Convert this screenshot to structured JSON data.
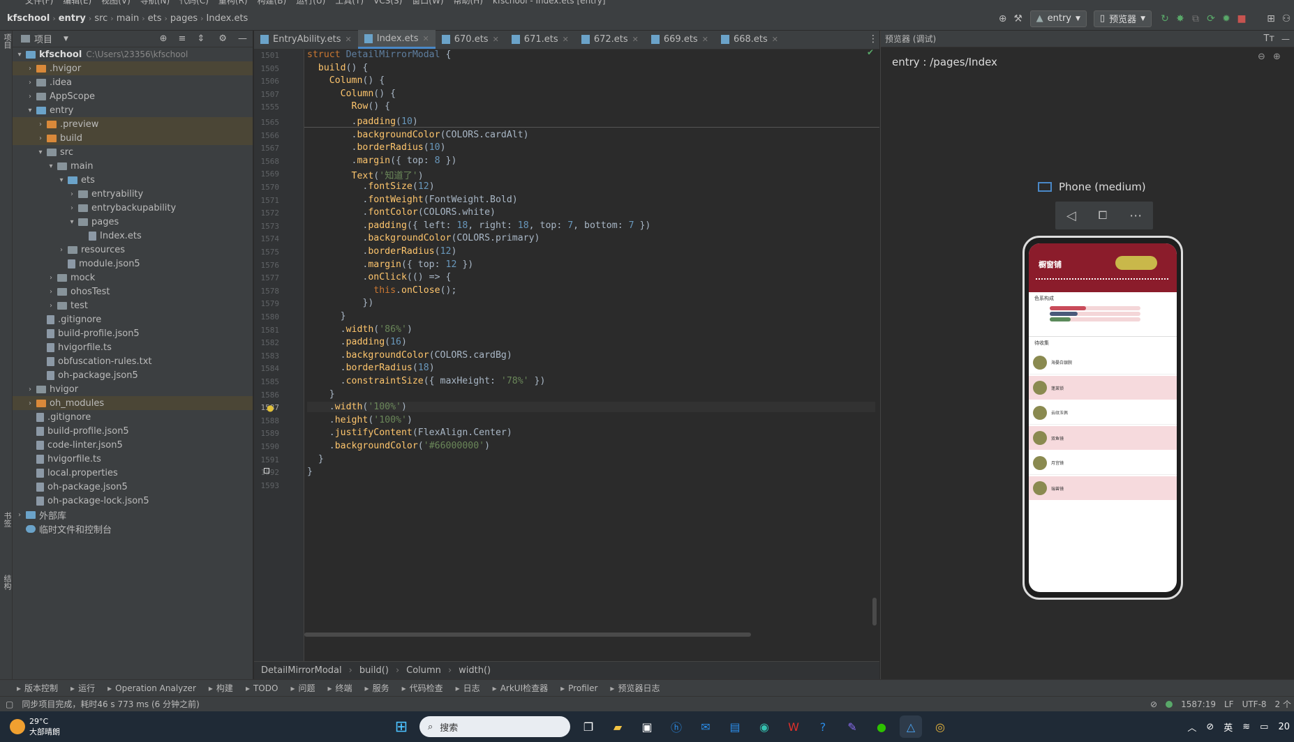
{
  "menu": [
    "文件(F)",
    "编辑(E)",
    "视图(V)",
    "导航(N)",
    "代码(C)",
    "重构(R)",
    "构建(B)",
    "运行(U)",
    "工具(T)",
    "VCS(S)",
    "窗口(W)",
    "帮助(H)",
    "kfschool - Index.ets [entry]"
  ],
  "navbar": {
    "crumbs": [
      "kfschool",
      "entry",
      "src",
      "main",
      "ets",
      "pages",
      "Index.ets"
    ],
    "run_config": "entry",
    "preview_button": "预览器"
  },
  "left_strip": {
    "top_label": "项目",
    "mid_label": "书签",
    "bottom_label": "结构"
  },
  "project": {
    "title": "项目",
    "tree": [
      {
        "label": "kfschool",
        "path": "C:\\Users\\23356\\kfschool",
        "level": 0,
        "arrow": "▾",
        "type": "folder-mod",
        "bold": true
      },
      {
        "label": ".hvigor",
        "level": 1,
        "arrow": "›",
        "type": "folder-orange",
        "hl": true
      },
      {
        "label": ".idea",
        "level": 1,
        "arrow": "›",
        "type": "folder"
      },
      {
        "label": "AppScope",
        "level": 1,
        "arrow": "›",
        "type": "folder"
      },
      {
        "label": "entry",
        "level": 1,
        "arrow": "▾",
        "type": "folder-mod"
      },
      {
        "label": ".preview",
        "level": 2,
        "arrow": "›",
        "type": "folder-orange",
        "hl": true
      },
      {
        "label": "build",
        "level": 2,
        "arrow": "›",
        "type": "folder-orange",
        "hl": true
      },
      {
        "label": "src",
        "level": 2,
        "arrow": "▾",
        "type": "folder"
      },
      {
        "label": "main",
        "level": 3,
        "arrow": "▾",
        "type": "folder"
      },
      {
        "label": "ets",
        "level": 4,
        "arrow": "▾",
        "type": "folder-blue"
      },
      {
        "label": "entryability",
        "level": 5,
        "arrow": "›",
        "type": "folder"
      },
      {
        "label": "entrybackupability",
        "level": 5,
        "arrow": "›",
        "type": "folder"
      },
      {
        "label": "pages",
        "level": 5,
        "arrow": "▾",
        "type": "folder"
      },
      {
        "label": "Index.ets",
        "level": 6,
        "arrow": "",
        "type": "file"
      },
      {
        "label": "resources",
        "level": 4,
        "arrow": "›",
        "type": "folder"
      },
      {
        "label": "module.json5",
        "level": 4,
        "arrow": "",
        "type": "file"
      },
      {
        "label": "mock",
        "level": 3,
        "arrow": "›",
        "type": "folder"
      },
      {
        "label": "ohosTest",
        "level": 3,
        "arrow": "›",
        "type": "folder"
      },
      {
        "label": "test",
        "level": 3,
        "arrow": "›",
        "type": "folder"
      },
      {
        "label": ".gitignore",
        "level": 2,
        "arrow": "",
        "type": "file"
      },
      {
        "label": "build-profile.json5",
        "level": 2,
        "arrow": "",
        "type": "file"
      },
      {
        "label": "hvigorfile.ts",
        "level": 2,
        "arrow": "",
        "type": "file"
      },
      {
        "label": "obfuscation-rules.txt",
        "level": 2,
        "arrow": "",
        "type": "file"
      },
      {
        "label": "oh-package.json5",
        "level": 2,
        "arrow": "",
        "type": "file"
      },
      {
        "label": "hvigor",
        "level": 1,
        "arrow": "›",
        "type": "folder"
      },
      {
        "label": "oh_modules",
        "level": 1,
        "arrow": "›",
        "type": "folder-orange",
        "hl": true
      },
      {
        "label": ".gitignore",
        "level": 1,
        "arrow": "",
        "type": "file"
      },
      {
        "label": "build-profile.json5",
        "level": 1,
        "arrow": "",
        "type": "file"
      },
      {
        "label": "code-linter.json5",
        "level": 1,
        "arrow": "",
        "type": "file"
      },
      {
        "label": "hvigorfile.ts",
        "level": 1,
        "arrow": "",
        "type": "file"
      },
      {
        "label": "local.properties",
        "level": 1,
        "arrow": "",
        "type": "file"
      },
      {
        "label": "oh-package.json5",
        "level": 1,
        "arrow": "",
        "type": "file"
      },
      {
        "label": "oh-package-lock.json5",
        "level": 1,
        "arrow": "",
        "type": "file"
      },
      {
        "label": "外部库",
        "level": 0,
        "arrow": "›",
        "type": "lib"
      },
      {
        "label": "临时文件和控制台",
        "level": 0,
        "arrow": "",
        "type": "scratch"
      }
    ]
  },
  "tabs": [
    {
      "label": "EntryAbility.ets",
      "active": false
    },
    {
      "label": "Index.ets",
      "active": true
    },
    {
      "label": "670.ets",
      "active": false
    },
    {
      "label": "671.ets",
      "active": false
    },
    {
      "label": "672.ets",
      "active": false
    },
    {
      "label": "669.ets",
      "active": false
    },
    {
      "label": "668.ets",
      "active": false
    }
  ],
  "editor": {
    "current_line": "1587",
    "lines": [
      {
        "n": "1501",
        "toks": [
          [
            "kw",
            "struct "
          ],
          [
            "cls",
            "DetailMirrorModal "
          ],
          [
            "plain",
            "{"
          ]
        ]
      },
      {
        "n": "1505",
        "toks": [
          [
            "plain",
            "  "
          ],
          [
            "fn",
            "build"
          ],
          [
            "plain",
            "() {"
          ]
        ]
      },
      {
        "n": "1506",
        "toks": [
          [
            "plain",
            "    "
          ],
          [
            "fn",
            "Column"
          ],
          [
            "plain",
            "() {"
          ]
        ]
      },
      {
        "n": "1507",
        "toks": [
          [
            "plain",
            "      "
          ],
          [
            "fn",
            "Column"
          ],
          [
            "plain",
            "() {"
          ]
        ]
      },
      {
        "n": "1555",
        "toks": [
          [
            "plain",
            "        "
          ],
          [
            "fn",
            "Row"
          ],
          [
            "plain",
            "() {"
          ]
        ]
      },
      {
        "n": "1565",
        "toks": [
          [
            "plain",
            "        ."
          ],
          [
            "mt",
            "padding"
          ],
          [
            "plain",
            "("
          ],
          [
            "num",
            "10"
          ],
          [
            "plain",
            ")"
          ]
        ]
      },
      {
        "n": "1566",
        "toks": [
          [
            "plain",
            "        ."
          ],
          [
            "mt",
            "backgroundColor"
          ],
          [
            "plain",
            "(COLORS."
          ],
          [
            "plain",
            "cardAlt"
          ],
          [
            "plain",
            ")"
          ]
        ]
      },
      {
        "n": "1567",
        "toks": [
          [
            "plain",
            "        ."
          ],
          [
            "mt",
            "borderRadius"
          ],
          [
            "plain",
            "("
          ],
          [
            "num",
            "10"
          ],
          [
            "plain",
            ")"
          ]
        ]
      },
      {
        "n": "1568",
        "toks": [
          [
            "plain",
            "        ."
          ],
          [
            "mt",
            "margin"
          ],
          [
            "plain",
            "({ top: "
          ],
          [
            "num",
            "8"
          ],
          [
            "plain",
            " })"
          ]
        ]
      },
      {
        "n": "1569",
        "toks": [
          [
            "plain",
            "        "
          ],
          [
            "fn",
            "Text"
          ],
          [
            "plain",
            "("
          ],
          [
            "str",
            "'知道了'"
          ],
          [
            "plain",
            ")"
          ]
        ]
      },
      {
        "n": "1570",
        "toks": [
          [
            "plain",
            "          ."
          ],
          [
            "mt",
            "fontSize"
          ],
          [
            "plain",
            "("
          ],
          [
            "num",
            "12"
          ],
          [
            "plain",
            ")"
          ]
        ]
      },
      {
        "n": "1571",
        "toks": [
          [
            "plain",
            "          ."
          ],
          [
            "mt",
            "fontWeight"
          ],
          [
            "plain",
            "(FontWeight.Bold)"
          ]
        ]
      },
      {
        "n": "1572",
        "toks": [
          [
            "plain",
            "          ."
          ],
          [
            "mt",
            "fontColor"
          ],
          [
            "plain",
            "(COLORS.white)"
          ]
        ]
      },
      {
        "n": "1573",
        "toks": [
          [
            "plain",
            "          ."
          ],
          [
            "mt",
            "padding"
          ],
          [
            "plain",
            "({ left: "
          ],
          [
            "num",
            "18"
          ],
          [
            "plain",
            ", right: "
          ],
          [
            "num",
            "18"
          ],
          [
            "plain",
            ", top: "
          ],
          [
            "num",
            "7"
          ],
          [
            "plain",
            ", bottom: "
          ],
          [
            "num",
            "7"
          ],
          [
            "plain",
            " })"
          ]
        ]
      },
      {
        "n": "1574",
        "toks": [
          [
            "plain",
            "          ."
          ],
          [
            "mt",
            "backgroundColor"
          ],
          [
            "plain",
            "(COLORS.primary)"
          ]
        ]
      },
      {
        "n": "1575",
        "toks": [
          [
            "plain",
            "          ."
          ],
          [
            "mt",
            "borderRadius"
          ],
          [
            "plain",
            "("
          ],
          [
            "num",
            "12"
          ],
          [
            "plain",
            ")"
          ]
        ]
      },
      {
        "n": "1576",
        "toks": [
          [
            "plain",
            "          ."
          ],
          [
            "mt",
            "margin"
          ],
          [
            "plain",
            "({ top: "
          ],
          [
            "num",
            "12"
          ],
          [
            "plain",
            " })"
          ]
        ]
      },
      {
        "n": "1577",
        "toks": [
          [
            "plain",
            "          ."
          ],
          [
            "mt",
            "onClick"
          ],
          [
            "plain",
            "(() => {"
          ]
        ]
      },
      {
        "n": "1578",
        "toks": [
          [
            "plain",
            "            "
          ],
          [
            "kw",
            "this"
          ],
          [
            "plain",
            "."
          ],
          [
            "mt",
            "onClose"
          ],
          [
            "plain",
            "();"
          ]
        ]
      },
      {
        "n": "1579",
        "toks": [
          [
            "plain",
            "          })"
          ]
        ]
      },
      {
        "n": "1580",
        "toks": [
          [
            "plain",
            "      }"
          ]
        ]
      },
      {
        "n": "1581",
        "toks": [
          [
            "plain",
            "      ."
          ],
          [
            "mt",
            "width"
          ],
          [
            "plain",
            "("
          ],
          [
            "str",
            "'86%'"
          ],
          [
            "plain",
            ")"
          ]
        ]
      },
      {
        "n": "1582",
        "toks": [
          [
            "plain",
            "      ."
          ],
          [
            "mt",
            "padding"
          ],
          [
            "plain",
            "("
          ],
          [
            "num",
            "16"
          ],
          [
            "plain",
            ")"
          ]
        ]
      },
      {
        "n": "1583",
        "toks": [
          [
            "plain",
            "      ."
          ],
          [
            "mt",
            "backgroundColor"
          ],
          [
            "plain",
            "(COLORS.cardBg)"
          ]
        ]
      },
      {
        "n": "1584",
        "toks": [
          [
            "plain",
            "      ."
          ],
          [
            "mt",
            "borderRadius"
          ],
          [
            "plain",
            "("
          ],
          [
            "num",
            "18"
          ],
          [
            "plain",
            ")"
          ]
        ]
      },
      {
        "n": "1585",
        "toks": [
          [
            "plain",
            "      ."
          ],
          [
            "mt",
            "constraintSize"
          ],
          [
            "plain",
            "({ maxHeight: "
          ],
          [
            "str",
            "'78%'"
          ],
          [
            "plain",
            " })"
          ]
        ]
      },
      {
        "n": "1586",
        "toks": [
          [
            "plain",
            "    }"
          ]
        ]
      },
      {
        "n": "1587",
        "toks": [
          [
            "plain",
            "    ."
          ],
          [
            "mt",
            "width"
          ],
          [
            "plain",
            "("
          ],
          [
            "str",
            "'100%'"
          ],
          [
            "plain",
            ")"
          ]
        ]
      },
      {
        "n": "1588",
        "toks": [
          [
            "plain",
            "    ."
          ],
          [
            "mt",
            "height"
          ],
          [
            "plain",
            "("
          ],
          [
            "str",
            "'100%'"
          ],
          [
            "plain",
            ")"
          ]
        ]
      },
      {
        "n": "1589",
        "toks": [
          [
            "plain",
            "    ."
          ],
          [
            "mt",
            "justifyContent"
          ],
          [
            "plain",
            "(FlexAlign.Center)"
          ]
        ]
      },
      {
        "n": "1590",
        "toks": [
          [
            "plain",
            "    ."
          ],
          [
            "mt",
            "backgroundColor"
          ],
          [
            "plain",
            "("
          ],
          [
            "str",
            "'#66000000'"
          ],
          [
            "plain",
            ")"
          ]
        ]
      },
      {
        "n": "1591",
        "toks": [
          [
            "plain",
            "  }"
          ]
        ]
      },
      {
        "n": "1592",
        "toks": [
          [
            "plain",
            "}"
          ]
        ]
      },
      {
        "n": "1593",
        "toks": []
      }
    ],
    "breadcrumb": [
      "DetailMirrorModal",
      "build()",
      "Column",
      "width()"
    ]
  },
  "preview": {
    "title": "预览器 (调试)",
    "path": "entry : /pages/Index",
    "device": "Phone (medium)",
    "app": {
      "title": "橱窗铺",
      "section1": "色系构成",
      "section2": "待收集",
      "items": [
        "海晏白银腕",
        "蓬莱锁",
        "云纹玉佩",
        "双鱼镜",
        "月宫镜",
        "瑞兽镜"
      ]
    }
  },
  "toolstrip": [
    "版本控制",
    "运行",
    "Operation Analyzer",
    "构建",
    "TODO",
    "问题",
    "终端",
    "服务",
    "代码检查",
    "日志",
    "ArkUI检查器",
    "Profiler",
    "预览器日志"
  ],
  "status": {
    "message": "同步项目完成，耗时46 s 773 ms (6 分钟之前)",
    "position": "1587:19",
    "line_sep": "LF",
    "encoding": "UTF-8",
    "indent": "2 个"
  },
  "taskbar": {
    "weather_temp": "29°C",
    "weather_desc": "大部晴朗",
    "search_placeholder": "搜索",
    "ime": "英",
    "clock": "20"
  },
  "colors": {
    "accent": "#4a88c7",
    "bg": "#2b2b2b",
    "panel": "#3c3f41",
    "app_primary": "#8b1c2b"
  }
}
